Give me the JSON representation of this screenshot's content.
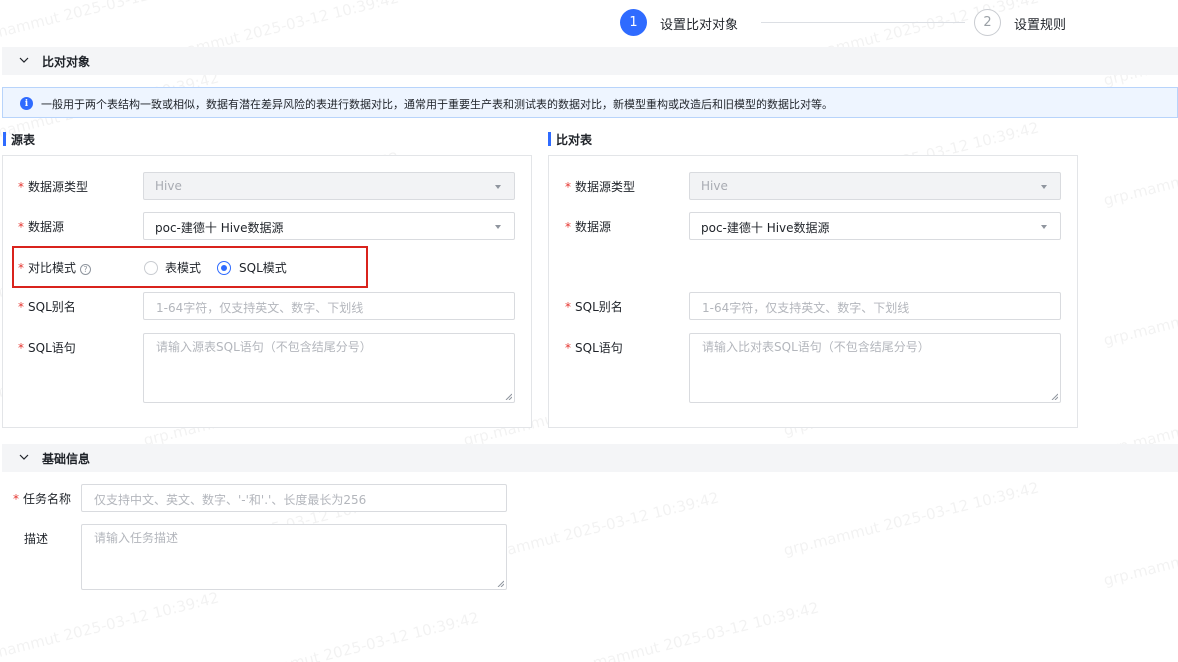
{
  "steps": [
    {
      "number": "1",
      "label": "设置比对对象"
    },
    {
      "number": "2",
      "label": "设置规则"
    }
  ],
  "section_compare": {
    "title": "比对对象"
  },
  "alert": {
    "text": "一般用于两个表结构一致或相似，数据有潜在差异风险的表进行数据对比，通常用于重要生产表和测试表的数据对比，新模型重构或改造后和旧模型的数据比对等。"
  },
  "source": {
    "title": "源表",
    "datasource_type": {
      "label": "数据源类型",
      "value": "Hive"
    },
    "datasource": {
      "label": "数据源",
      "value": "poc-建德十 Hive数据源"
    },
    "compare_mode": {
      "label": "对比模式",
      "options": [
        "表模式",
        "SQL模式"
      ],
      "selected": "SQL模式"
    },
    "sql_alias": {
      "label": "SQL别名",
      "placeholder": "1-64字符，仅支持英文、数字、下划线"
    },
    "sql_statement": {
      "label": "SQL语句",
      "placeholder": "请输入源表SQL语句（不包含结尾分号）"
    }
  },
  "target": {
    "title": "比对表",
    "datasource_type": {
      "label": "数据源类型",
      "value": "Hive"
    },
    "datasource": {
      "label": "数据源",
      "value": "poc-建德十 Hive数据源"
    },
    "sql_alias": {
      "label": "SQL别名",
      "placeholder": "1-64字符，仅支持英文、数字、下划线"
    },
    "sql_statement": {
      "label": "SQL语句",
      "placeholder": "请输入比对表SQL语句（不包含结尾分号）"
    }
  },
  "section_basic": {
    "title": "基础信息"
  },
  "basic": {
    "task_name": {
      "label": "任务名称",
      "placeholder": "仅支持中文、英文、数字、'-'和'.'、长度最长为256"
    },
    "description": {
      "label": "描述",
      "placeholder": "请输入任务描述"
    }
  },
  "required_mark": "*",
  "help_glyph": "?",
  "watermark": "grp.mammut 2025-03-12 10:39:42",
  "colors": {
    "accent": "#2f6bff",
    "required": "#e5352f",
    "highlight": "#d9231c",
    "alert_bg": "#eef5ff"
  }
}
